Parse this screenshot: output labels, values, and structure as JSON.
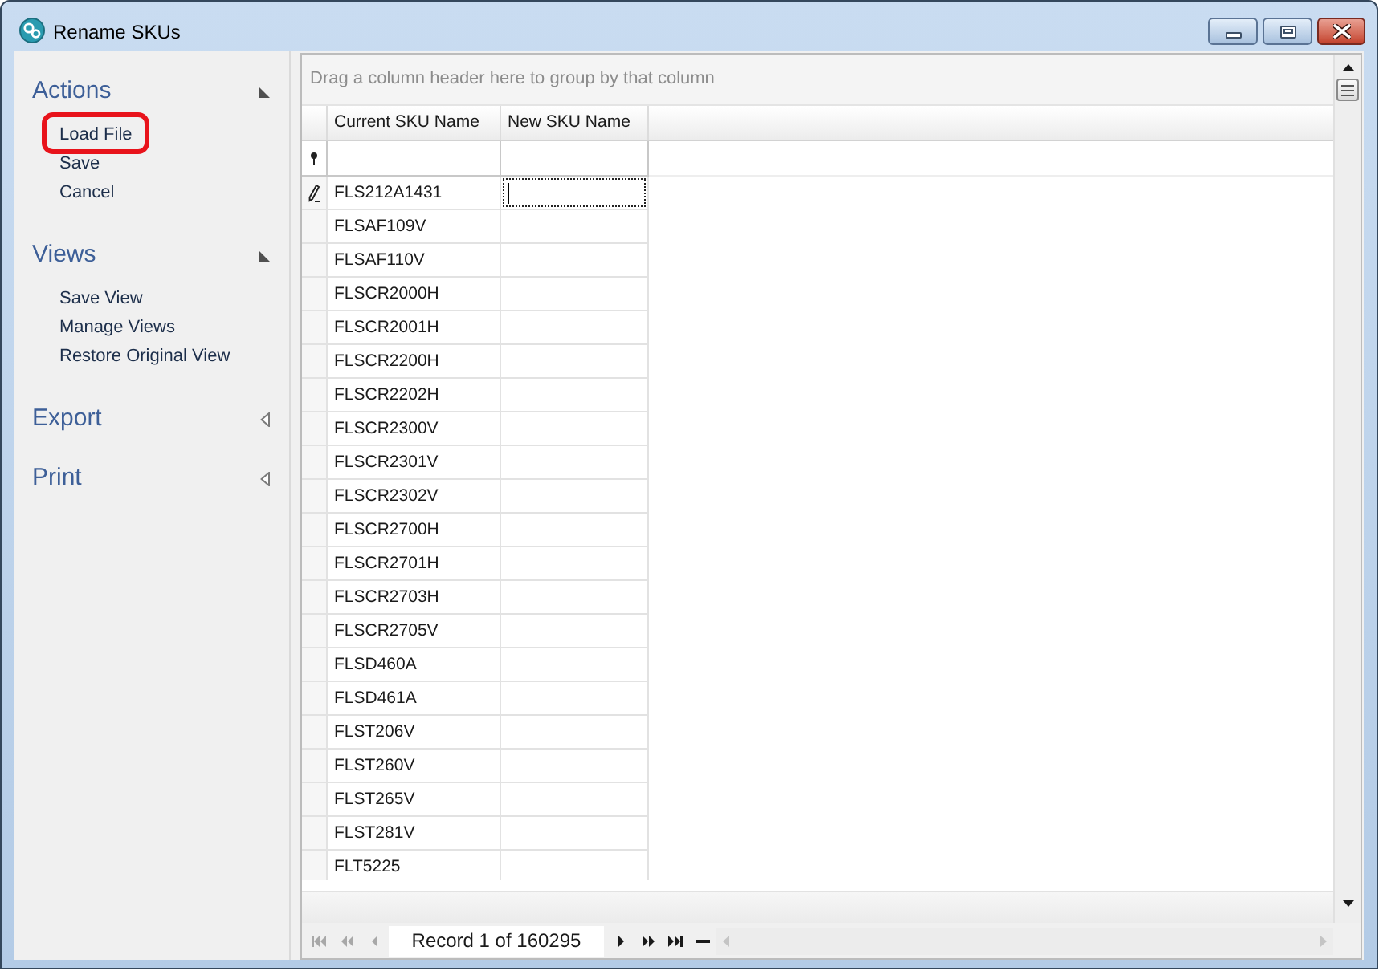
{
  "window": {
    "title": "Rename SKUs"
  },
  "sidebar": {
    "groups": [
      {
        "title": "Actions",
        "expanded": true,
        "items": [
          {
            "label": "Load File",
            "highlighted": true
          },
          {
            "label": "Save",
            "highlighted": false
          },
          {
            "label": "Cancel",
            "highlighted": false
          }
        ]
      },
      {
        "title": "Views",
        "expanded": true,
        "items": [
          {
            "label": "Save View",
            "highlighted": false
          },
          {
            "label": "Manage Views",
            "highlighted": false
          },
          {
            "label": "Restore Original View",
            "highlighted": false
          }
        ]
      },
      {
        "title": "Export",
        "expanded": false
      },
      {
        "title": "Print",
        "expanded": false
      }
    ]
  },
  "grid": {
    "group_panel": {
      "hint": "Drag a column header here to group by that column"
    },
    "columns": [
      {
        "title": "Current SKU Name"
      },
      {
        "title": "New SKU Name"
      }
    ],
    "rows": [
      {
        "current_sku_name": "FLS212A1431",
        "editing": true
      },
      {
        "current_sku_name": "FLSAF109V",
        "editing": false
      },
      {
        "current_sku_name": "FLSAF110V",
        "editing": false
      },
      {
        "current_sku_name": "FLSCR2000H",
        "editing": false
      },
      {
        "current_sku_name": "FLSCR2001H",
        "editing": false
      },
      {
        "current_sku_name": "FLSCR2200H",
        "editing": false
      },
      {
        "current_sku_name": "FLSCR2202H",
        "editing": false
      },
      {
        "current_sku_name": "FLSCR2300V",
        "editing": false
      },
      {
        "current_sku_name": "FLSCR2301V",
        "editing": false
      },
      {
        "current_sku_name": "FLSCR2302V",
        "editing": false
      },
      {
        "current_sku_name": "FLSCR2700H",
        "editing": false
      },
      {
        "current_sku_name": "FLSCR2701H",
        "editing": false
      },
      {
        "current_sku_name": "FLSCR2703H",
        "editing": false
      },
      {
        "current_sku_name": "FLSCR2705V",
        "editing": false
      },
      {
        "current_sku_name": "FLSD460A",
        "editing": false
      },
      {
        "current_sku_name": "FLSD461A",
        "editing": false
      },
      {
        "current_sku_name": "FLST206V",
        "editing": false
      },
      {
        "current_sku_name": "FLST260V",
        "editing": false
      },
      {
        "current_sku_name": "FLST265V",
        "editing": false
      },
      {
        "current_sku_name": "FLST281V",
        "editing": false
      },
      {
        "current_sku_name": "FLT5225",
        "editing": false
      }
    ]
  },
  "navigator": {
    "left_buttons": [
      {
        "kind": "first",
        "disabled": true
      },
      {
        "kind": "prev_page",
        "disabled": true
      },
      {
        "kind": "prev",
        "disabled": true
      }
    ],
    "record_text": "Record 1 of 160295",
    "right_buttons": [
      {
        "kind": "next",
        "disabled": false
      },
      {
        "kind": "next_page",
        "disabled": false
      },
      {
        "kind": "last",
        "disabled": false
      },
      {
        "kind": "remove",
        "disabled": false
      }
    ]
  }
}
